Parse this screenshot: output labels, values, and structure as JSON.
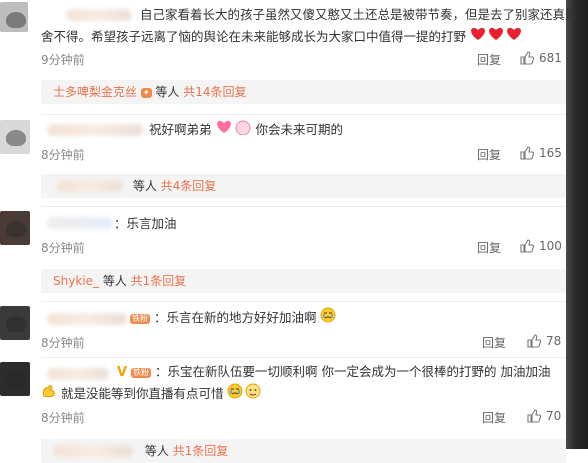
{
  "comments": [
    {
      "text_line1": "自己家看着长大的孩子虽然又傻又憨又土还总是被带节奏，但是去了别家还真是",
      "text_line2": "舍不得。希望孩子远离了恼的舆论在未来能够成长为大家口中值得一提的打野",
      "time": "9分钟前",
      "reply_label": "回复",
      "likes": "681"
    },
    {
      "text": "祝好啊弟弟",
      "text_tail": "你会未来可期的",
      "time": "8分钟前",
      "reply_label": "回复",
      "likes": "165"
    },
    {
      "text": "：乐言加油",
      "time": "8分钟前",
      "reply_label": "回复",
      "likes": "100"
    },
    {
      "badge": "铁粉",
      "text": "：乐言在新的地方好好加油啊",
      "time": "8分钟前",
      "reply_label": "回复",
      "likes": "78"
    },
    {
      "badge": "铁粉",
      "vmark": "V",
      "text_line1": "：乐宝在新队伍要一切顺利啊 你一定会成为一个很棒的打野的 加油加油",
      "text_line2": "就是没能等到你直播有点可惜",
      "time": "8分钟前",
      "reply_label": "回复",
      "likes": "70"
    }
  ],
  "reply_bars": [
    {
      "name": "士多啤梨金克丝",
      "who": "等人",
      "count": "共14条回复"
    },
    {
      "name": "",
      "who": "等人",
      "count": "共4条回复"
    },
    {
      "name": "Shykie_",
      "who": "等人",
      "count": "共1条回复"
    },
    {
      "name": "",
      "who": "等人",
      "count": "共1条回复"
    }
  ],
  "colors": {
    "accent": "#eb7350",
    "heart": "#e8212e",
    "muted": "#888888"
  },
  "icons": [
    "thumbs-up-icon",
    "heart-emoji",
    "cry-emoji"
  ]
}
